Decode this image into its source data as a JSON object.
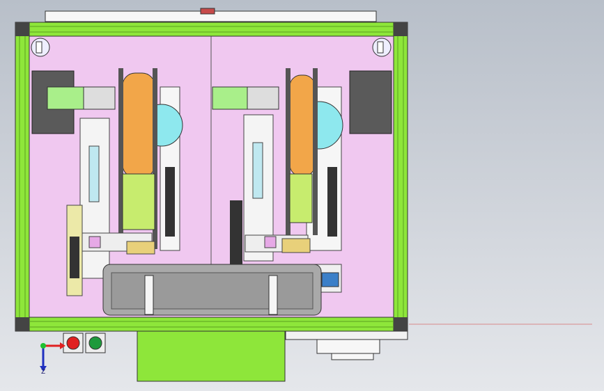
{
  "scene": {
    "view": "top view",
    "background_colors": [
      "#b8bfc9",
      "#e5e7eb"
    ],
    "frame_color": "#8ee63a",
    "panel_color": "#f0c8f0",
    "tray_color": "#a9a9a9",
    "spool_color": "#f2a649",
    "disc_color": "#8ee8ee",
    "cassette_color": "#c7ec6e",
    "motor_color": "#a9ef8a",
    "box_color": "#8ee63a"
  },
  "controls": {
    "emergency_stop": {
      "icon": "emergency-stop-button",
      "color": "#e02020"
    },
    "start": {
      "icon": "start-button",
      "color": "#1e9a3c"
    }
  },
  "axes": {
    "vertical_label": "Z",
    "horizontal_color": "#e02020",
    "vertical_color": "#2030c0",
    "origin_color": "#20c030"
  }
}
